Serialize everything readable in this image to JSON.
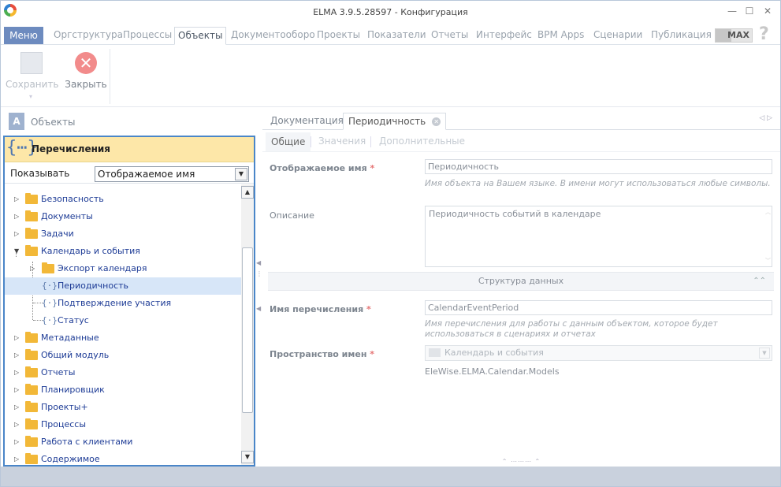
{
  "window": {
    "title": "ELMA 3.9.5.28597 - Конфигурация",
    "controls": {
      "minimize": "—",
      "maximize": "☐",
      "close": "✕"
    }
  },
  "menubar": {
    "menu_label": "Меню",
    "tabs": [
      {
        "label": "Оргструктура"
      },
      {
        "label": "Процессы"
      },
      {
        "label": "Объекты"
      },
      {
        "label": "Документооборо"
      },
      {
        "label": "Проекты"
      },
      {
        "label": "Показатели"
      },
      {
        "label": "Отчеты"
      },
      {
        "label": "Интерфейс"
      },
      {
        "label": "BPM Apps"
      },
      {
        "label": "Сценарии"
      },
      {
        "label": "Публикация"
      }
    ],
    "active_tab": "Объекты",
    "max_label": "MAX",
    "help": "?"
  },
  "ribbon": {
    "save_label": "Сохранить",
    "close_label": "Закрыть",
    "close_glyph": "✕",
    "dropdown_glyph": "▾"
  },
  "left": {
    "objects_label": "Объекты",
    "objects_icon_letter": "A",
    "panel_title": "Перечисления",
    "brace_glyph": "{⋯}",
    "show_label": "Показывать",
    "show_value": "Отображаемое имя",
    "tree": [
      {
        "label": "Безопасность"
      },
      {
        "label": "Документы"
      },
      {
        "label": "Задачи"
      },
      {
        "label": "Календарь и события"
      },
      {
        "label": "Экспорт календаря"
      },
      {
        "label": "Периодичность"
      },
      {
        "label": "Подтверждение участия"
      },
      {
        "label": "Статус"
      },
      {
        "label": "Метаданные"
      },
      {
        "label": "Общий модуль"
      },
      {
        "label": "Отчеты"
      },
      {
        "label": "Планировщик"
      },
      {
        "label": "Проекты+"
      },
      {
        "label": "Процессы"
      },
      {
        "label": "Работа с клиентами"
      },
      {
        "label": "Содержимое"
      }
    ],
    "selected": "Периодичность"
  },
  "right": {
    "tabs": [
      {
        "label": "Документация"
      },
      {
        "label": "Периодичность"
      }
    ],
    "subtabs": [
      {
        "label": "Общие"
      },
      {
        "label": "Значения"
      },
      {
        "label": "Дополнительные"
      }
    ],
    "form": {
      "display_name_label": "Отображаемое имя",
      "display_name_value": "Периодичность",
      "display_name_hint": "Имя объекта на Вашем языке. В имени могут использоваться любые символы.",
      "description_label": "Описание",
      "description_value": "Периодичность событий в календаре",
      "section_title": "Структура данных",
      "enum_name_label": "Имя перечисления",
      "enum_name_value": "CalendarEventPeriod",
      "enum_name_hint": "Имя перечисления для работы с данным объектом, которое будет использоваться в сценариях и отчетах",
      "namespace_label": "Пространство имен",
      "namespace_value": "Календарь и события",
      "namespace_full": "EleWise.ELMA.Calendar.Models",
      "required_mark": "*"
    }
  },
  "colors": {
    "accent": "#4a86c8",
    "menu_button": "#6d8bbf",
    "panel_header": "#fde7a8",
    "folder": "#f2b838",
    "selection": "#d7e6f8",
    "link_text": "#1e3c96"
  }
}
